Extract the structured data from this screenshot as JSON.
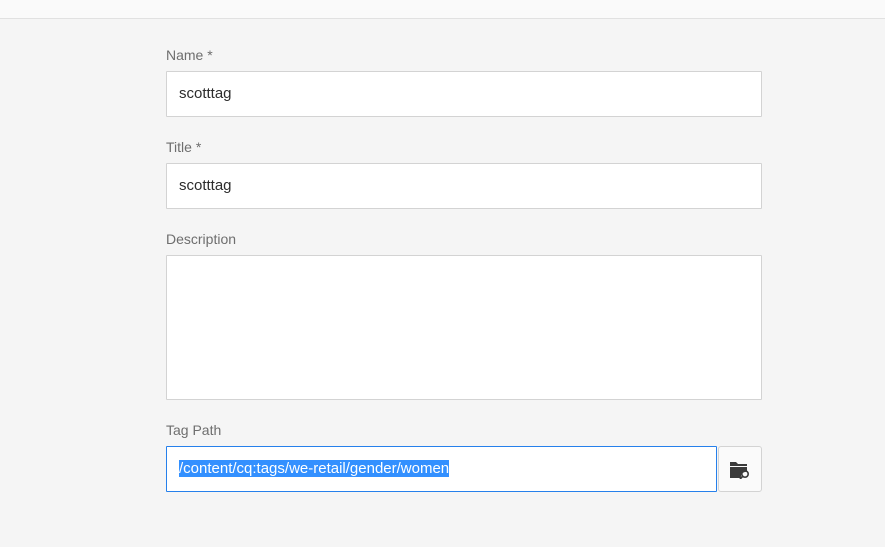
{
  "form": {
    "name": {
      "label": "Name *",
      "value": "scotttag"
    },
    "title": {
      "label": "Title *",
      "value": "scotttag"
    },
    "description": {
      "label": "Description",
      "value": ""
    },
    "tag_path": {
      "label": "Tag Path",
      "value": "/content/cq:tags/we-retail/gender/women",
      "browse_icon": "folder-search-icon"
    }
  },
  "colors": {
    "background": "#f5f5f5",
    "focus_border": "#2680eb",
    "selection": "#3390ff"
  }
}
